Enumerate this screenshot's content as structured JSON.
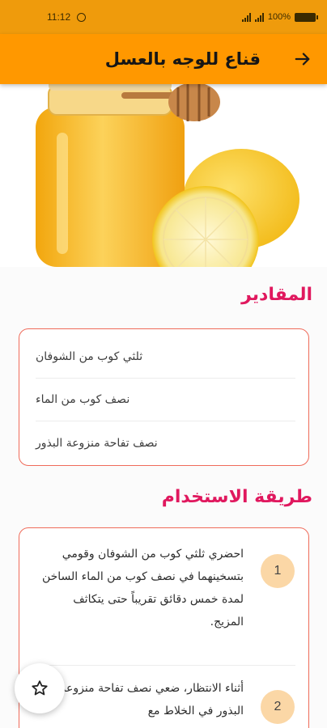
{
  "status_bar": {
    "time": "11:12",
    "battery": "100%"
  },
  "app_bar": {
    "title": "قناع للوجه بالعسل",
    "back_icon": "arrow-right-icon"
  },
  "hero_image": {
    "alt": "honey-jar-with-lemons"
  },
  "ingredients": {
    "title": "المقادير",
    "items": [
      "ثلثي كوب من الشوفان",
      "نصف كوب من الماء",
      "نصف تفاحة منزوعة البذور"
    ]
  },
  "usage": {
    "title": "طريقة الاستخدام",
    "steps": [
      {
        "number": "1",
        "text": "احضري ثلثي كوب من الشوفان وقومي بتسخينهما في نصف كوب من الماء الساخن لمدة خمس دقائق تقريباً حتى يتكاثف المزيج."
      },
      {
        "number": "2",
        "text": "أثناء الانتظار، ضعي نصف تفاحة منزوعة البذور في الخلاط مع"
      }
    ]
  },
  "fab": {
    "icon": "star-outline-icon"
  },
  "colors": {
    "status_bar": "#ef9b0c",
    "app_bar": "#ff9800",
    "section_title": "#e0185e",
    "card_border": "#ef6b5a",
    "step_badge": "#fbd7a6"
  }
}
